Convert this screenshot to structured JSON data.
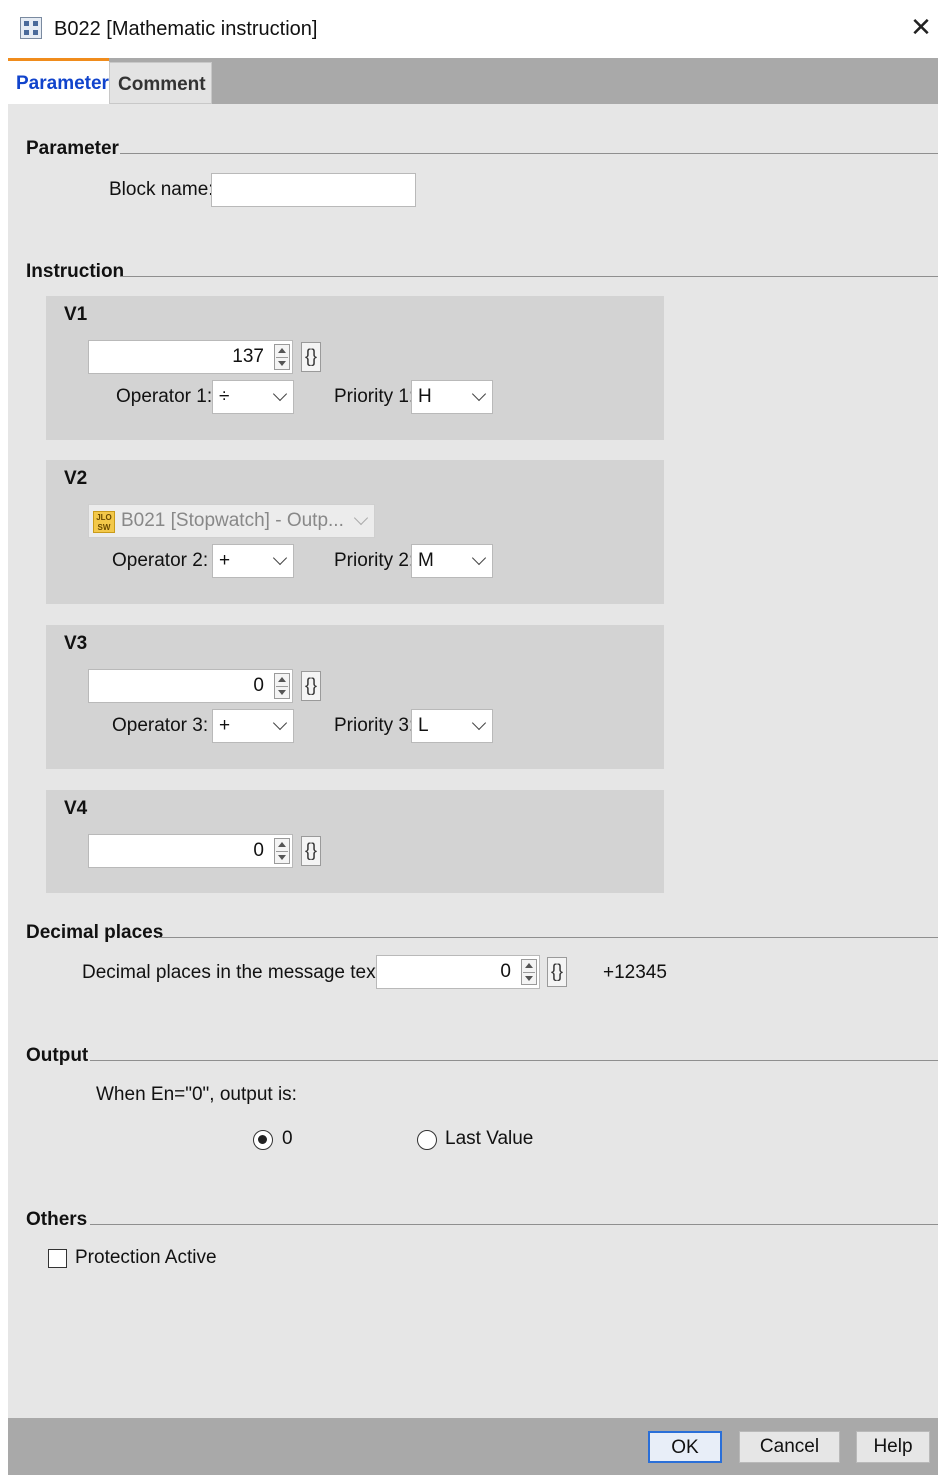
{
  "window": {
    "title": "B022 [Mathematic instruction]",
    "close_icon": "close-icon"
  },
  "tabs": [
    {
      "label": "Parameter",
      "active": true
    },
    {
      "label": "Comment",
      "active": false
    }
  ],
  "parameter_section": {
    "heading": "Parameter",
    "block_name_label": "Block name:",
    "block_name_value": ""
  },
  "instruction_section": {
    "heading": "Instruction",
    "groups": {
      "v1": {
        "title": "V1",
        "value": "137",
        "operator_label": "Operator 1:",
        "operator": "÷",
        "priority_label": "Priority 1:",
        "priority": "H"
      },
      "v2": {
        "title": "V2",
        "reference": "B021 [Stopwatch] - Outp...",
        "reference_icon_top": "JLO",
        "reference_icon_bottom": "SW",
        "operator_label": "Operator 2:",
        "operator": "+",
        "priority_label": "Priority 2:",
        "priority": "M"
      },
      "v3": {
        "title": "V3",
        "value": "0",
        "operator_label": "Operator 3:",
        "operator": "+",
        "priority_label": "Priority 3:",
        "priority": "L"
      },
      "v4": {
        "title": "V4",
        "value": "0"
      }
    }
  },
  "decimal_section": {
    "heading": "Decimal places",
    "label": "Decimal places in the message text:",
    "value": "0",
    "preview": "+12345"
  },
  "output_section": {
    "heading": "Output",
    "description": "When En=\"0\", output is:",
    "options": [
      {
        "label": "0",
        "selected": true
      },
      {
        "label": "Last Value",
        "selected": false
      }
    ]
  },
  "others_section": {
    "heading": "Others",
    "protection_label": "Protection Active",
    "protection_checked": false
  },
  "buttons": {
    "ok": "OK",
    "cancel": "Cancel",
    "help": "Help"
  },
  "brace_glyph": "{}",
  "colors": {
    "active_tab_text": "#1144cc",
    "active_tab_accent": "#f08c1c",
    "panel_bg": "#e6e6e6",
    "group_bg": "#d3d3d3"
  }
}
